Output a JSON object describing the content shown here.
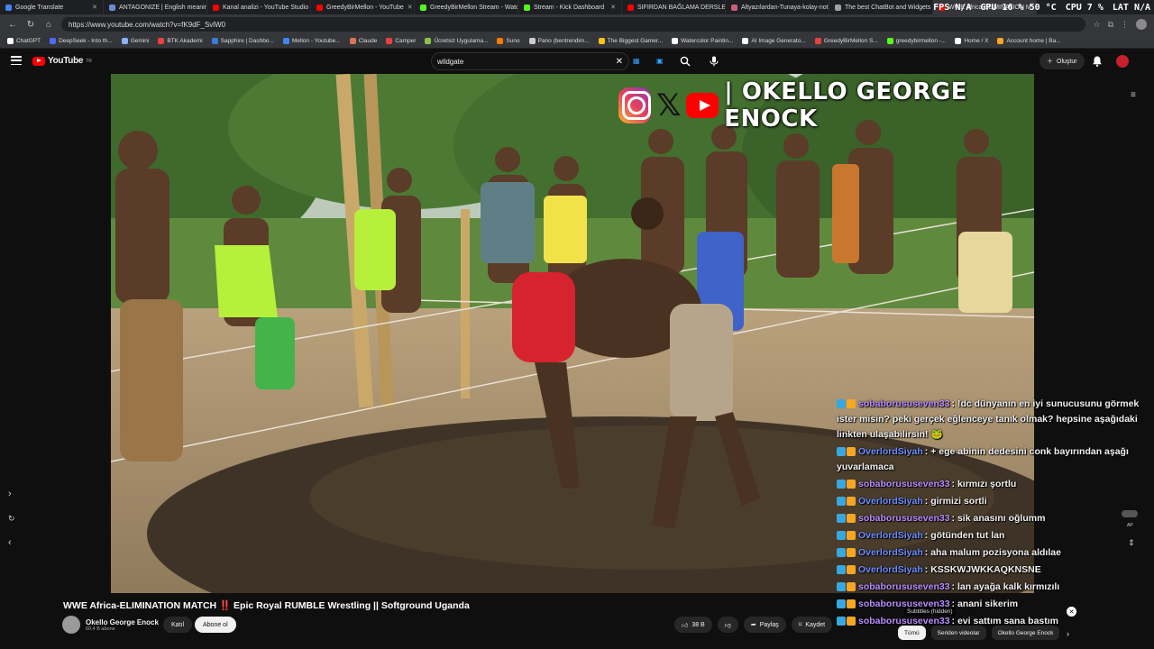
{
  "tabs": [
    {
      "label": "Google Translate",
      "color": "#4285f4"
    },
    {
      "label": "ANTAGONIZE | English meaning",
      "color": "#6b8bd6"
    },
    {
      "label": "Kanal analizi - YouTube Studio",
      "color": "#ff0000"
    },
    {
      "label": "GreedyBirMellon - YouTube",
      "color": "#ff0000"
    },
    {
      "label": "GreedyBirMellon Stream - Watch",
      "color": "#53fc18"
    },
    {
      "label": "Stream - Kick Dashboard",
      "color": "#53fc18"
    },
    {
      "label": "SIFIRDAN BAĞLAMA DERSLERİ",
      "color": "#ff0000"
    },
    {
      "label": "Altyazılardan-Tunaya-kolay-nota",
      "color": "#d05b7a"
    },
    {
      "label": "The best ChatBot and Widgets",
      "color": "#a0a0a0"
    },
    {
      "label": "WWE Africa-ELIMINATION M",
      "color": "#ff0000"
    }
  ],
  "hud": {
    "fps_label": "FPS",
    "fps": "N/A",
    "gpu_label": "GPU",
    "gpu": "16 % 50 °C",
    "cpu_label": "CPU",
    "cpu": "7 %",
    "lat_label": "LAT",
    "lat": "N/A"
  },
  "url": "https://www.youtube.com/watch?v=fK9dF_SvlW0",
  "bookmarks": [
    {
      "label": "ChatGPT",
      "color": "#ffffff"
    },
    {
      "label": "DeepSeek - Into th...",
      "color": "#4d6bfe"
    },
    {
      "label": "Gemini",
      "color": "#8ab4f8"
    },
    {
      "label": "BTK Akademi",
      "color": "#e94040"
    },
    {
      "label": "Sapphire | Dashbo...",
      "color": "#3a7bd5"
    },
    {
      "label": "Mellon - Youtube...",
      "color": "#4285f4"
    },
    {
      "label": "Claude",
      "color": "#d97757"
    },
    {
      "label": "Camper",
      "color": "#e94040"
    },
    {
      "label": "Ücretsiz Uygulama...",
      "color": "#8bc34a"
    },
    {
      "label": "Suno",
      "color": "#ff7a00"
    },
    {
      "label": "Pano (bentrendim...",
      "color": "#cccccc"
    },
    {
      "label": "The Biggest Gamer...",
      "color": "#f5c518"
    },
    {
      "label": "Watercolor Paintin...",
      "color": "#ffffff"
    },
    {
      "label": "AI Image Generato...",
      "color": "#ffffff"
    },
    {
      "label": "GreedyBirMellon S...",
      "color": "#e94040"
    },
    {
      "label": "greedybirmellon -...",
      "color": "#53fc18"
    },
    {
      "label": "Home / X",
      "color": "#ffffff"
    },
    {
      "label": "Account home | Ba...",
      "color": "#f5a623"
    }
  ],
  "youtube": {
    "logo": "YouTube",
    "logo_region": "TR",
    "search_query": "wildgate",
    "create_label": "Oluştur"
  },
  "video": {
    "brand_name": "| OKELLO GEORGE ENOCK",
    "title": "WWE Africa-ELIMINATION MATCH ‼️ Epic Royal RUMBLE Wrestling || Softground Uganda",
    "channel_name": "Okello George Enock",
    "subscribers": "60,4 B abone",
    "join_label": "Katıl",
    "subscribe_label": "Abone ol",
    "likes": "38 B",
    "share_label": "Paylaş",
    "save_label": "Kaydet",
    "subtitles_hidden": "Subtitles (hidden)",
    "side_label": "AP"
  },
  "chips": [
    {
      "label": "Tümü",
      "active": true
    },
    {
      "label": "Seriden videolar",
      "active": false
    },
    {
      "label": "Okello George Enock",
      "active": false
    }
  ],
  "chat": [
    {
      "user": "sobaborususeven33",
      "color": "#b98bff",
      "text": "!dc dünyanın en iyi sunucusunu görmek ister misin? peki gerçek eğlenceye tanık olmak? hepsine aşağıdaki linkten ulaşabilirsin! 🐸"
    },
    {
      "user": "OverlordSiyah",
      "color": "#6d8dff",
      "text": "+ ege abinin dedesini conk bayırından aşağı yuvarlamaca"
    },
    {
      "user": "sobaborususeven33",
      "color": "#b98bff",
      "text": "kırmızı şortlu"
    },
    {
      "user": "OverlordSiyah",
      "color": "#6d8dff",
      "text": "girmizi sortli"
    },
    {
      "user": "sobaborususeven33",
      "color": "#b98bff",
      "text": "sik anasını oğlumm"
    },
    {
      "user": "OverlordSiyah",
      "color": "#6d8dff",
      "text": "götünden tut lan"
    },
    {
      "user": "OverlordSiyah",
      "color": "#6d8dff",
      "text": "aha malum pozisyona aldılae"
    },
    {
      "user": "OverlordSiyah",
      "color": "#6d8dff",
      "text": "KSSKWJWKKAQKNSNE"
    },
    {
      "user": "sobaborususeven33",
      "color": "#b98bff",
      "text": "lan ayağa kalk kırmızılı"
    },
    {
      "user": "sobaborususeven33",
      "color": "#b98bff",
      "text": "anani sikerim"
    },
    {
      "user": "sobaborususeven33",
      "color": "#b98bff",
      "text": "evi sattım sana bastım"
    }
  ]
}
